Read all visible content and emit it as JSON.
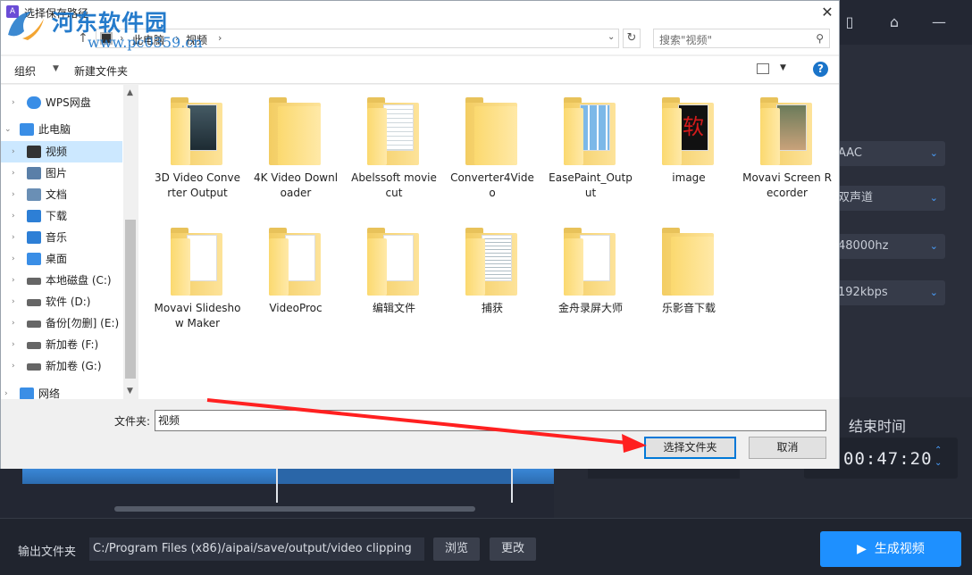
{
  "dialog": {
    "title": "选择保存路径",
    "close_symbol": "✕",
    "watermark": {
      "text": "河东软件园",
      "url": "www.pc0359.cn"
    },
    "breadcrumb": [
      "此电脑",
      "视频"
    ],
    "breadcrumb_sep": "›",
    "search_placeholder": "搜索\"视频\"",
    "toolbar": {
      "organize": "组织",
      "new_folder": "新建文件夹"
    },
    "nav_items": [
      {
        "label": "WPS网盘",
        "icon": "cloud-icon"
      },
      {
        "label": "此电脑",
        "icon": "computer-icon"
      },
      {
        "label": "视频",
        "icon": "video-folder-icon",
        "selected": true
      },
      {
        "label": "图片",
        "icon": "pictures-folder-icon"
      },
      {
        "label": "文档",
        "icon": "documents-folder-icon"
      },
      {
        "label": "下载",
        "icon": "download-folder-icon"
      },
      {
        "label": "音乐",
        "icon": "music-folder-icon"
      },
      {
        "label": "桌面",
        "icon": "desktop-folder-icon"
      },
      {
        "label": "本地磁盘 (C:)",
        "icon": "drive-icon"
      },
      {
        "label": "软件 (D:)",
        "icon": "drive-icon"
      },
      {
        "label": "备份[勿删] (E:)",
        "icon": "drive-icon"
      },
      {
        "label": "新加卷 (F:)",
        "icon": "drive-icon"
      },
      {
        "label": "新加卷 (G:)",
        "icon": "drive-icon"
      },
      {
        "label": "网络",
        "icon": "network-icon"
      }
    ],
    "folders": [
      {
        "name": "3D Video Converter Output"
      },
      {
        "name": "4K Video Downloader"
      },
      {
        "name": "Abelssoft moviecut"
      },
      {
        "name": "Converter4Video"
      },
      {
        "name": "EasePaint_Output"
      },
      {
        "name": "image"
      },
      {
        "name": "Movavi Screen Recorder"
      },
      {
        "name": "Movavi Slideshow Maker"
      },
      {
        "name": "VideoProc"
      },
      {
        "name": "编辑文件"
      },
      {
        "name": "捕获"
      },
      {
        "name": "金舟录屏大师"
      },
      {
        "name": "乐影音下载"
      }
    ],
    "image_folder_glyph": "软",
    "folder_field_label": "文件夹:",
    "folder_field_value": "视频",
    "select_button": "选择文件夹",
    "cancel_button": "取消"
  },
  "app": {
    "dropdowns": [
      "AAC",
      "双声道",
      "48000hz",
      "192kbps"
    ],
    "end_time_label": "结束时间",
    "end_time_value": "00:47:20",
    "output_label": "输出文件夹",
    "output_path": "C:/Program Files (x86)/aipai/save/output/video clipping",
    "browse_button": "浏览",
    "change_button": "更改",
    "generate_button": "生成视频"
  },
  "colors": {
    "accent": "#1e90ff",
    "selection": "#cce8ff",
    "annotation_arrow": "#ff2020"
  }
}
